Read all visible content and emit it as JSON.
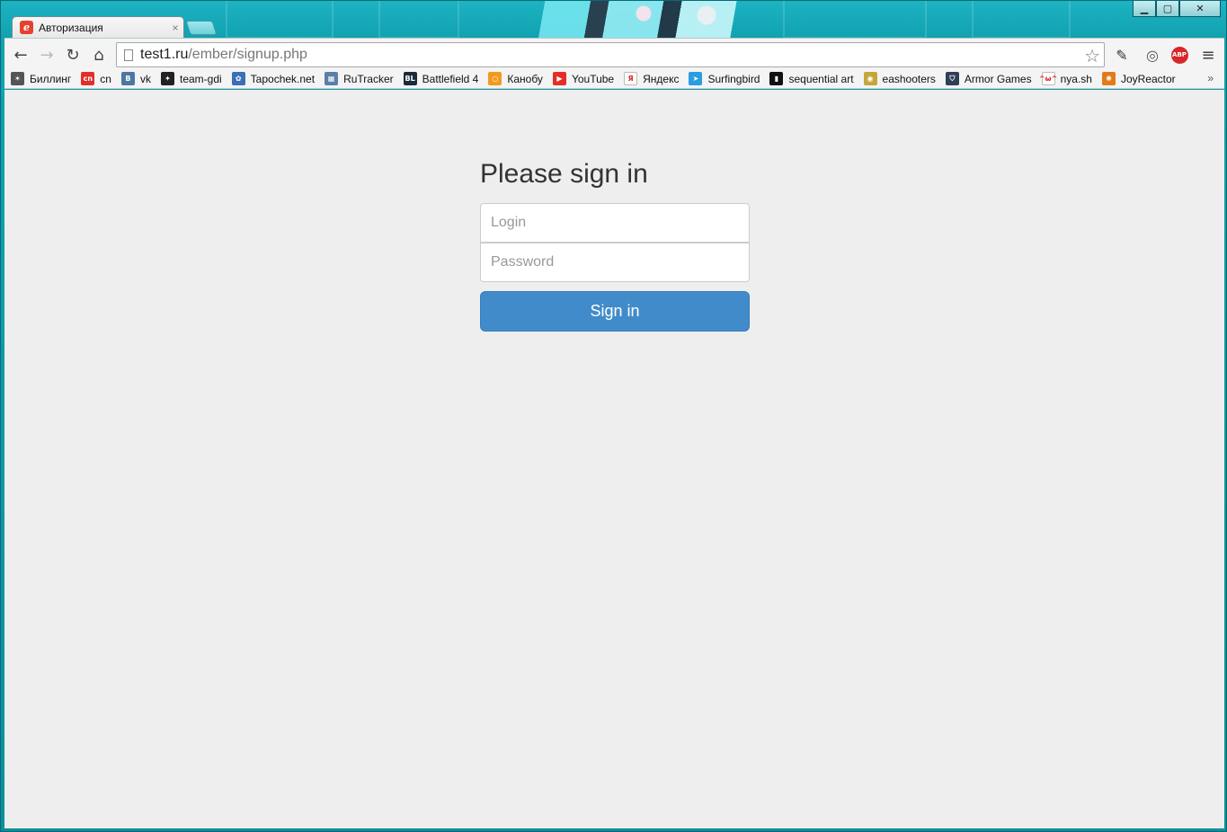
{
  "window": {
    "controls": {
      "minimize_icon": "minimize-icon",
      "maximize_icon": "maximize-icon",
      "close_icon": "close-icon"
    }
  },
  "tab": {
    "title": "Авторизация",
    "favicon_letter": "e",
    "close_glyph": "×"
  },
  "toolbar": {
    "url_host": "test1.ru",
    "url_path": "/ember/signup.php",
    "icons": [
      "back-icon",
      "forward-icon",
      "reload-icon",
      "home-icon",
      "bookmark-star-icon",
      "pen-extension-icon",
      "notification-extension-icon",
      "adblock-plus-icon",
      "chrome-menu-icon"
    ],
    "abp_label": "ABP"
  },
  "bookmarks": [
    {
      "label": "Биллинг",
      "icon": "billing-icon",
      "color": "#555555",
      "glyph": "✶"
    },
    {
      "label": "cn",
      "icon": "cn-icon",
      "color": "#e0302a",
      "glyph": "cn"
    },
    {
      "label": "vk",
      "icon": "vk-icon",
      "color": "#4d76a1",
      "glyph": "B"
    },
    {
      "label": "team-gdi",
      "icon": "team-gdi-icon",
      "color": "#222222",
      "glyph": "✦"
    },
    {
      "label": "Tapochek.net",
      "icon": "tapochek-icon",
      "color": "#3b6fb6",
      "glyph": "✿"
    },
    {
      "label": "RuTracker",
      "icon": "rutracker-icon",
      "color": "#5a7fa8",
      "glyph": "▦"
    },
    {
      "label": "Battlefield 4",
      "icon": "battlefield-icon",
      "color": "#1b2b3a",
      "glyph": "BL"
    },
    {
      "label": "Канобу",
      "icon": "kanobu-icon",
      "color": "#f39a1d",
      "glyph": "○"
    },
    {
      "label": "YouTube",
      "icon": "youtube-icon",
      "color": "#e52d27",
      "glyph": "▶"
    },
    {
      "label": "Яндекс",
      "icon": "yandex-icon",
      "color": "#ffffff",
      "glyph": "Я"
    },
    {
      "label": "Surfingbird",
      "icon": "surfingbird-icon",
      "color": "#2b9de0",
      "glyph": "➤"
    },
    {
      "label": "sequential art",
      "icon": "sequential-art-icon",
      "color": "#111111",
      "glyph": "▮"
    },
    {
      "label": "eashooters",
      "icon": "eashooters-icon",
      "color": "#c7a53a",
      "glyph": "◉"
    },
    {
      "label": "Armor Games",
      "icon": "armor-games-icon",
      "color": "#2e3f56",
      "glyph": "⛉"
    },
    {
      "label": "nya.sh",
      "icon": "nya-icon",
      "color": "#ffffff",
      "glyph": "^ω^"
    },
    {
      "label": "JoyReactor",
      "icon": "joyreactor-icon",
      "color": "#e37a1a",
      "glyph": "✺"
    }
  ],
  "bookmarks_more": "»",
  "signin": {
    "heading": "Please sign in",
    "login_placeholder": "Login",
    "password_placeholder": "Password",
    "submit_label": "Sign in"
  },
  "colors": {
    "primary_button": "#428bca",
    "page_background": "#eeeeee",
    "frame_accent": "#12a2b1"
  }
}
